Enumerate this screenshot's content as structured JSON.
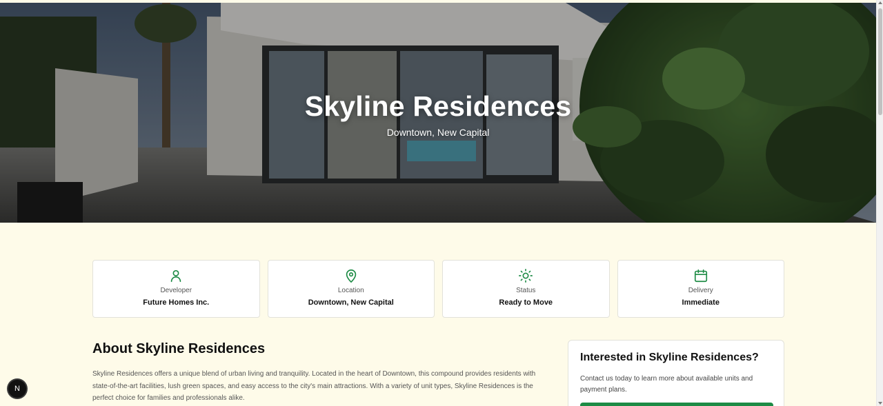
{
  "hero": {
    "title": "Skyline Residences",
    "subtitle": "Downtown, New Capital"
  },
  "info_cards": [
    {
      "icon": "user-icon",
      "label": "Developer",
      "value": "Future Homes Inc."
    },
    {
      "icon": "map-pin-icon",
      "label": "Location",
      "value": "Downtown, New Capital"
    },
    {
      "icon": "sun-icon",
      "label": "Status",
      "value": "Ready to Move"
    },
    {
      "icon": "calendar-icon",
      "label": "Delivery",
      "value": "Immediate"
    }
  ],
  "about": {
    "title": "About Skyline Residences",
    "text": "Skyline Residences offers a unique blend of urban living and tranquility. Located in the heart of Downtown, this compound provides residents with state-of-the-art facilities, lush green spaces, and easy access to the city's main attractions. With a variety of unit types, Skyline Residences is the perfect choice for families and professionals alike."
  },
  "interest": {
    "title": "Interested in Skyline Residences?",
    "text": "Contact us today to learn more about available units and payment plans."
  },
  "badge": {
    "letter": "N"
  },
  "colors": {
    "page_background": "#fefbe9",
    "accent_green": "#1d8b45",
    "card_border": "#e2e2da"
  }
}
